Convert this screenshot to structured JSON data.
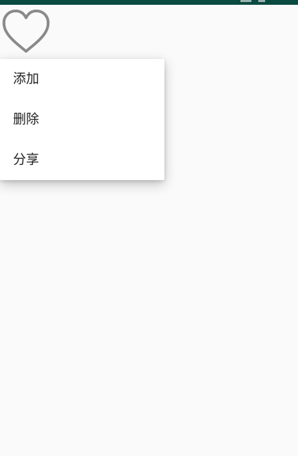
{
  "status_bar": {
    "color": "#0b4a40"
  },
  "favorite": {
    "icon": "heart-outline-icon",
    "color": "#8a8a8a"
  },
  "popup_menu": {
    "items": [
      {
        "label": "添加"
      },
      {
        "label": "删除"
      },
      {
        "label": "分享"
      }
    ]
  }
}
